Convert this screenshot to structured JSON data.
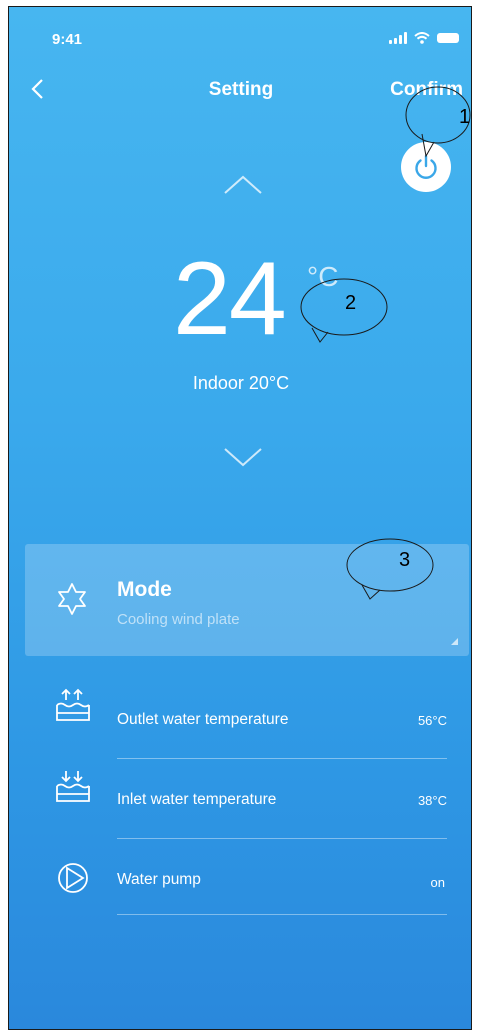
{
  "status_bar": {
    "time": "9:41"
  },
  "header": {
    "title": "Setting",
    "confirm_label": "Confirm"
  },
  "temperature": {
    "value": "24",
    "unit": "°C",
    "indoor_label": "Indoor 20°C"
  },
  "mode": {
    "title": "Mode",
    "subtitle": "Cooling wind plate"
  },
  "rows": [
    {
      "label": "Outlet  water temperature",
      "value": "56°C",
      "icon": "outlet-water-icon"
    },
    {
      "label": "Inlet water temperature",
      "value": "38°C",
      "icon": "inlet-water-icon"
    },
    {
      "label": "Water pump",
      "value": "on",
      "icon": "water-pump-icon"
    }
  ],
  "callouts": [
    "1",
    "2",
    "3"
  ],
  "colors": {
    "accent": "#3aa9ec",
    "power_icon": "#3aa7e8"
  }
}
